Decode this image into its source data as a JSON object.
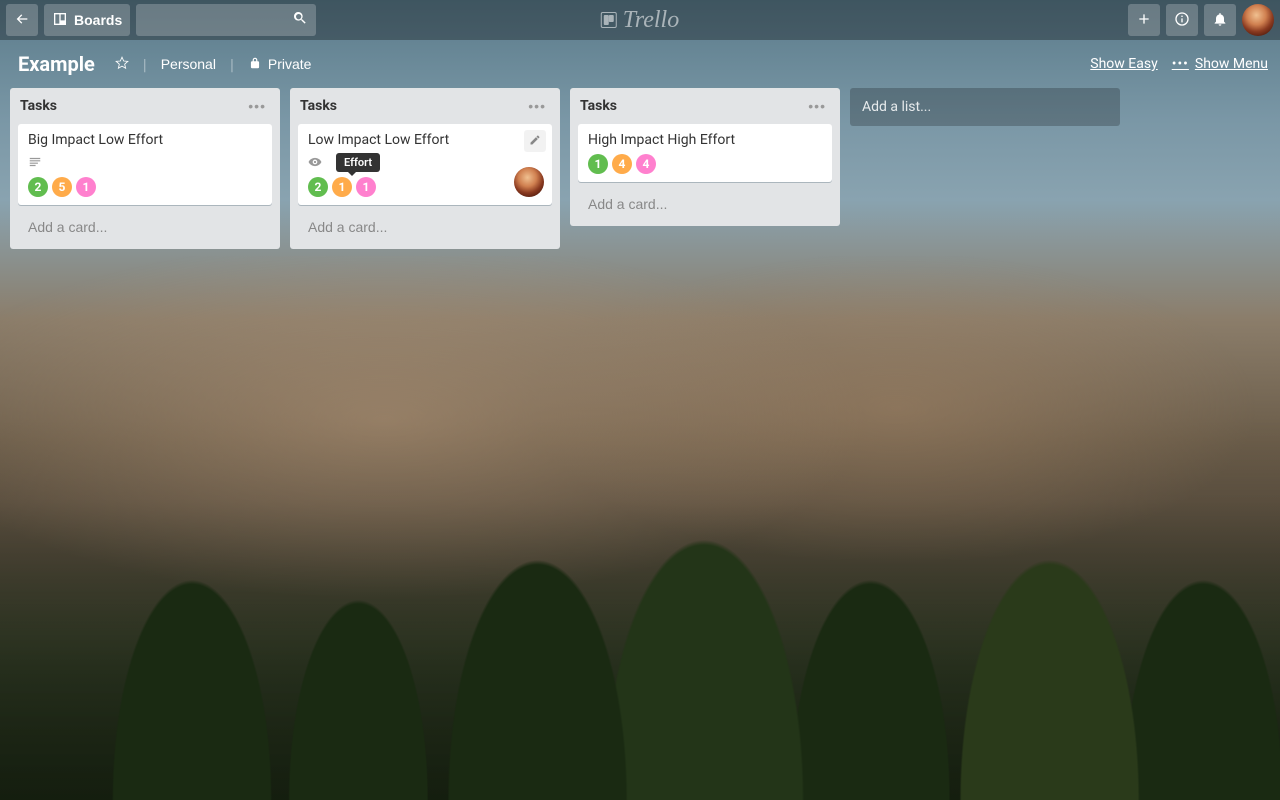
{
  "header": {
    "boards_label": "Boards",
    "logo_text": "Trello"
  },
  "board": {
    "name": "Example",
    "team": "Personal",
    "visibility": "Private",
    "show_easy": "Show Easy",
    "show_menu": "Show Menu"
  },
  "add_list_placeholder": "Add a list...",
  "add_card_label": "Add a card...",
  "tooltip_label": "Effort",
  "lists": [
    {
      "title": "Tasks",
      "cards": [
        {
          "title": "Big Impact Low Effort",
          "has_desc": true,
          "watching": false,
          "member": false,
          "show_edit": false,
          "show_tooltip": false,
          "labels": [
            {
              "color": "green",
              "value": "2"
            },
            {
              "color": "orange",
              "value": "5"
            },
            {
              "color": "pink",
              "value": "1"
            }
          ]
        }
      ]
    },
    {
      "title": "Tasks",
      "cards": [
        {
          "title": "Low Impact Low Effort",
          "has_desc": false,
          "watching": true,
          "member": true,
          "show_edit": true,
          "show_tooltip": true,
          "labels": [
            {
              "color": "green",
              "value": "2"
            },
            {
              "color": "orange",
              "value": "1"
            },
            {
              "color": "pink",
              "value": "1"
            }
          ]
        }
      ]
    },
    {
      "title": "Tasks",
      "cards": [
        {
          "title": "High Impact High Effort",
          "has_desc": false,
          "watching": false,
          "member": false,
          "show_edit": false,
          "show_tooltip": false,
          "labels": [
            {
              "color": "green",
              "value": "1"
            },
            {
              "color": "orange",
              "value": "4"
            },
            {
              "color": "pink",
              "value": "4"
            }
          ]
        }
      ]
    }
  ]
}
